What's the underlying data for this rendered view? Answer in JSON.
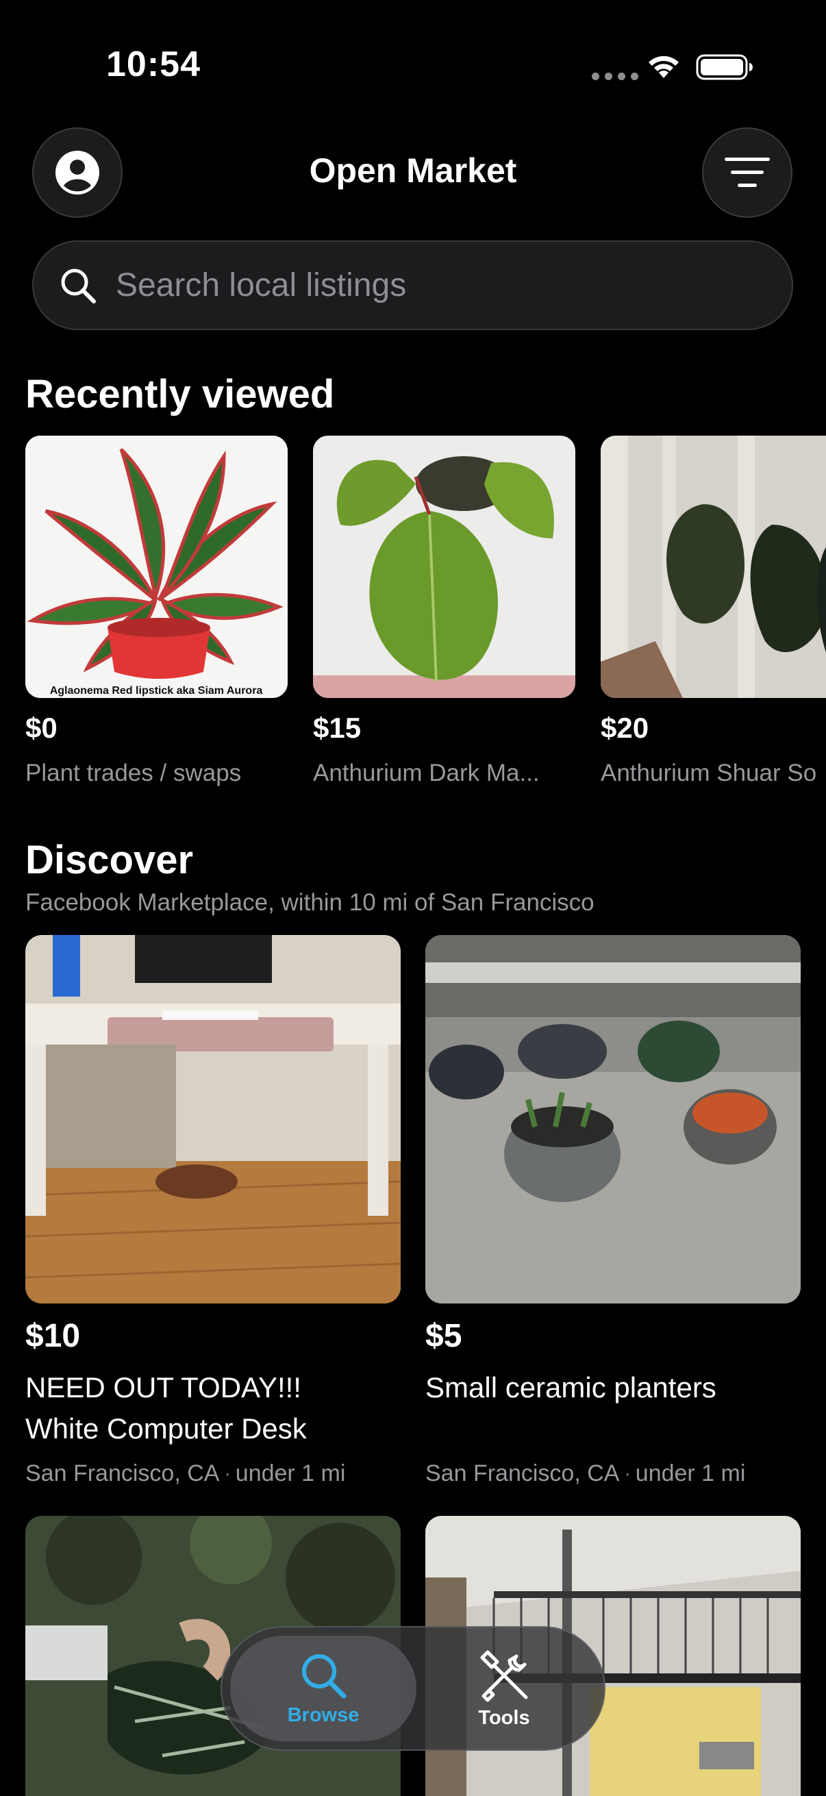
{
  "status_bar": {
    "time": "10:54"
  },
  "header": {
    "title": "Open Market"
  },
  "search": {
    "placeholder": "Search local listings"
  },
  "recently_viewed": {
    "title": "Recently viewed",
    "items": [
      {
        "price": "$0",
        "title": "Plant trades / swaps",
        "image_caption": "Aglaonema Red lipstick aka Siam Aurora"
      },
      {
        "price": "$15",
        "title": "Anthurium Dark Ma..."
      },
      {
        "price": "$20",
        "title": "Anthurium Shuar So"
      }
    ]
  },
  "discover": {
    "title": "Discover",
    "subtitle": "Facebook Marketplace, within 10 mi of San Francisco",
    "separator": "·",
    "items": [
      {
        "price": "$10",
        "title_line1": "NEED OUT TODAY!!!",
        "title_line2": "White Computer Desk",
        "location": "San Francisco, CA",
        "distance": "under 1 mi"
      },
      {
        "price": "$5",
        "title_line1": "Small ceramic planters",
        "title_line2": "",
        "location": "San Francisco, CA",
        "distance": "under 1 mi"
      }
    ]
  },
  "tab_bar": {
    "tabs": [
      {
        "label": "Browse",
        "icon": "search-icon",
        "active": true
      },
      {
        "label": "Tools",
        "icon": "tools-icon",
        "active": false
      }
    ]
  },
  "colors": {
    "accent": "#32ade6",
    "background": "#000000",
    "secondary_text": "#98989d"
  }
}
